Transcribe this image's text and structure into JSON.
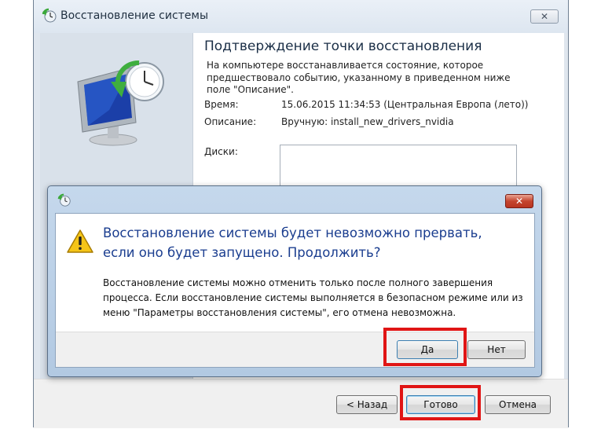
{
  "window": {
    "title": "Восстановление системы",
    "close_symbol": "✕"
  },
  "content": {
    "heading": "Подтверждение точки восстановления",
    "intro": "На компьютере восстанавливается состояние, которое предшествовало событию, указанному в приведенном ниже поле \"Описание\".",
    "time_label": "Время:",
    "time_value": "15.06.2015 11:34:53 (Центральная Европа (лето))",
    "description_label": "Описание:",
    "description_value": "Вручную: install_new_drivers_nvidia",
    "disks_label": "Диски:"
  },
  "buttons": {
    "back": "< Назад",
    "finish": "Готово",
    "cancel": "Отмена"
  },
  "dialog": {
    "close_symbol": "✕",
    "main_text": "Восстановление системы будет невозможно прервать, если оно будет запущено. Продолжить?",
    "detail_text": "Восстановление системы можно отменить только после полного завершения процесса. Если восстановление системы выполняется в безопасном режиме или из меню \"Параметры восстановления системы\", его отмена невозможна.",
    "yes": "Да",
    "no": "Нет"
  },
  "icons": {
    "app": "system-restore-icon",
    "wizard_art": "monitor-clock-restore-icon",
    "warning": "warning-triangle-icon"
  },
  "colors": {
    "highlight": "#e01515",
    "dialog_main_text": "#1a3d8f",
    "dialog_close": "#c5452f"
  }
}
